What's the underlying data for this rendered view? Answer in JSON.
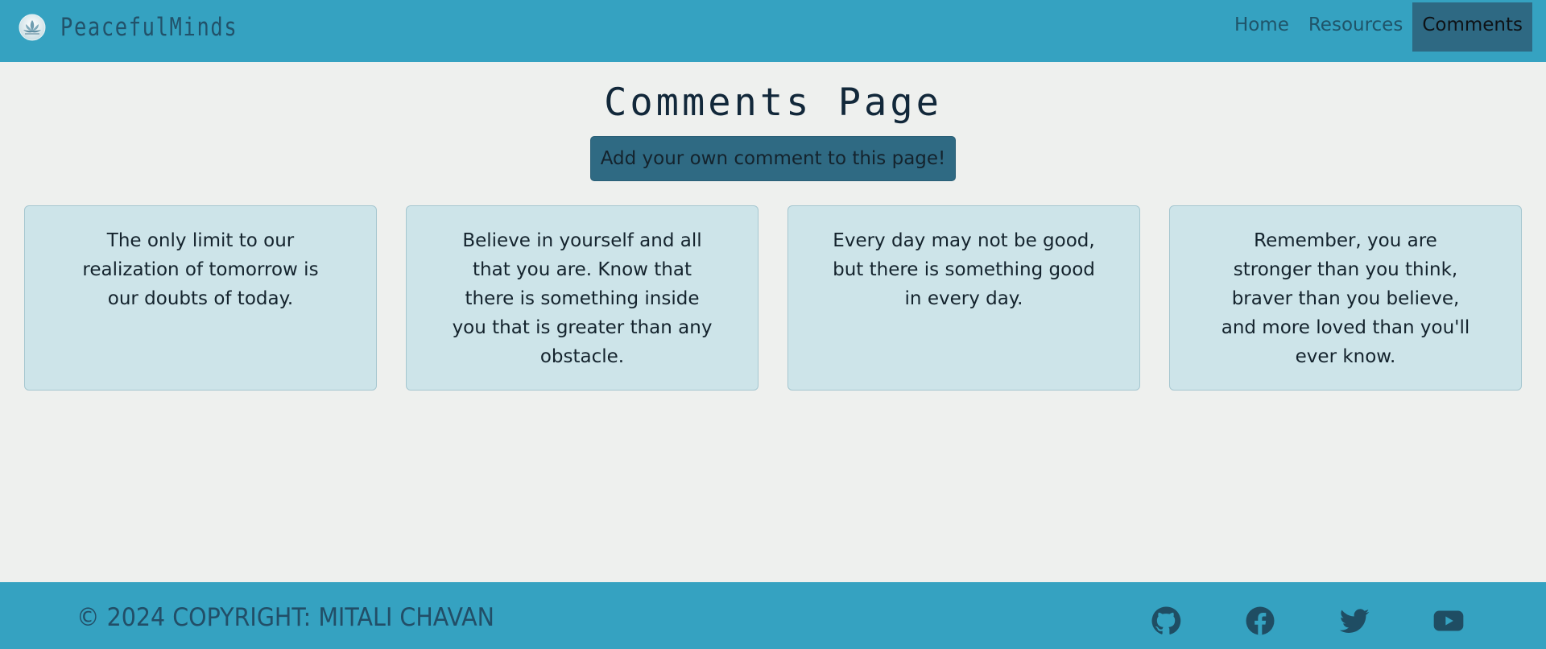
{
  "brand": {
    "name": "PeacefulMinds",
    "logo_icon": "lotus-logo-icon"
  },
  "nav": {
    "items": [
      {
        "label": "Home",
        "active": false
      },
      {
        "label": "Resources",
        "active": false
      },
      {
        "label": "Comments",
        "active": true
      }
    ]
  },
  "main": {
    "title": "Comments Page",
    "add_button_label": "Add your own comment to this page!",
    "comments": [
      {
        "text": "The only limit to our realization of tomorrow is our doubts of today."
      },
      {
        "text": "Believe in yourself and all that you are. Know that there is something inside you that is greater than any obstacle."
      },
      {
        "text": "Every day may not be good, but there is something good in every day."
      },
      {
        "text": "Remember, you are stronger than you think, braver than you believe, and more loved than you'll ever know."
      }
    ]
  },
  "footer": {
    "copyright": "© 2024 Copyright: Mitali Chavan",
    "social_icons": [
      "github-icon",
      "facebook-icon",
      "twitter-icon",
      "youtube-icon"
    ]
  },
  "colors": {
    "header_bg": "#35a2c1",
    "active_nav_bg": "#2e6983",
    "page_bg": "#eef0ee",
    "card_bg": "#cde4e9",
    "button_bg": "#2f6a83",
    "icon_color": "#1f4d63"
  }
}
